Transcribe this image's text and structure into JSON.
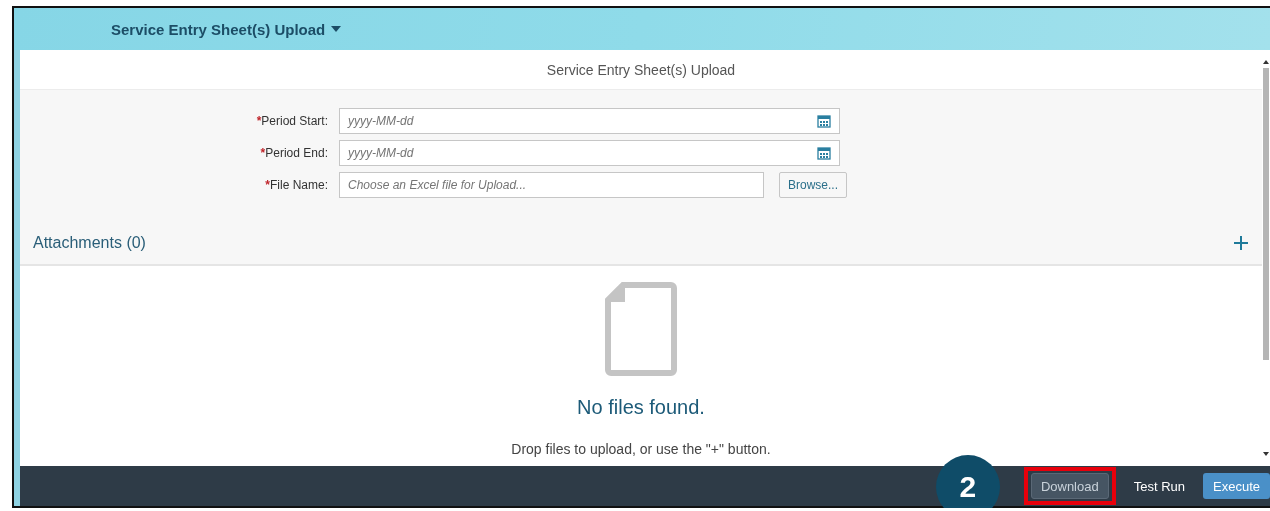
{
  "shell": {
    "title": "Service Entry Sheet(s) Upload"
  },
  "page": {
    "title": "Service Entry Sheet(s) Upload"
  },
  "form": {
    "fields": [
      {
        "required_mark": "*",
        "label": "Period Start:",
        "kind": "date",
        "placeholder": "yyyy-MM-dd"
      },
      {
        "required_mark": "*",
        "label": "Period End:",
        "kind": "date",
        "placeholder": "yyyy-MM-dd"
      },
      {
        "required_mark": "*",
        "label": "File Name:",
        "kind": "file",
        "placeholder": "Choose an Excel file for Upload...",
        "button": "Browse..."
      }
    ]
  },
  "attachments": {
    "title": "Attachments (0)",
    "empty_title": "No files found.",
    "empty_hint": "Drop files to upload, or use the \"+\" button."
  },
  "footer": {
    "buttons": [
      {
        "label": "Download",
        "kind": "default",
        "highlighted": true
      },
      {
        "label": "Test Run",
        "kind": "transparent",
        "highlighted": false
      },
      {
        "label": "Execute",
        "kind": "emphasized",
        "highlighted": false
      }
    ]
  },
  "callout": {
    "label": "2"
  }
}
